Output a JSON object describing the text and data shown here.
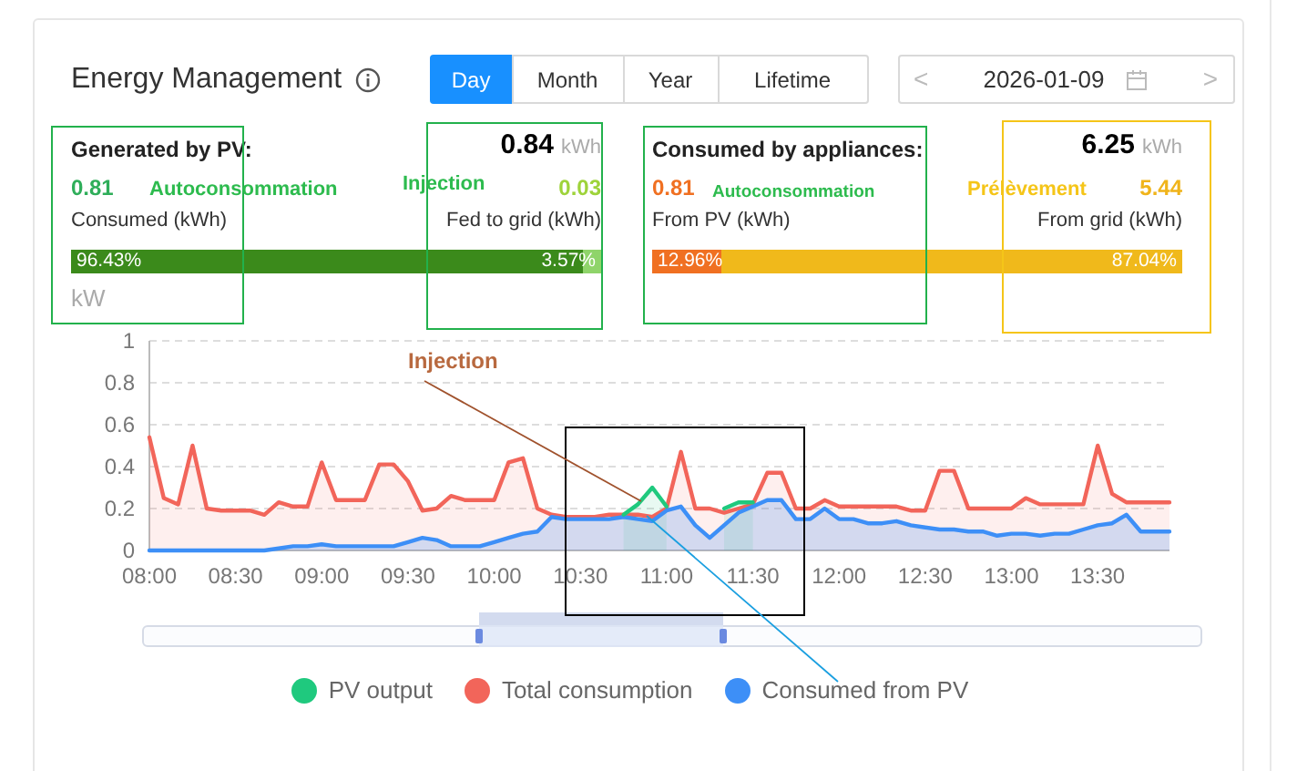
{
  "header": {
    "title": "Energy Management",
    "tabs": [
      {
        "label": "Day",
        "selected": true
      },
      {
        "label": "Month",
        "selected": false
      },
      {
        "label": "Year",
        "selected": false
      },
      {
        "label": "Lifetime",
        "selected": false
      }
    ],
    "prev": "<",
    "date": "2026-01-09",
    "next": ">"
  },
  "summaries": [
    {
      "kind": "generated",
      "title": "Generated by PV:",
      "total": "0.84",
      "unit": "kWh",
      "left": {
        "value": "0.81",
        "label": "Consumed (kWh)",
        "percent": "96.43%"
      },
      "right": {
        "value": "0.03",
        "label": "Fed to grid (kWh)",
        "percent": "3.57%"
      },
      "level": 0.9643
    },
    {
      "kind": "consumed",
      "title": "Consumed by appliances:",
      "total": "6.25",
      "unit": "kWh",
      "left": {
        "value": "0.81",
        "label": "From PV (kWh)",
        "percent": "12.96%"
      },
      "right": {
        "value": "5.44",
        "label": "From grid (kWh)",
        "percent": "87.04%"
      },
      "level": 0.1296
    }
  ],
  "chart": {
    "unit_label": "kW",
    "chart_data": {
      "type": "area",
      "grid": true,
      "x": [
        480,
        485,
        490,
        495,
        500,
        505,
        510,
        515,
        520,
        525,
        530,
        535,
        540,
        545,
        550,
        555,
        560,
        565,
        570,
        575,
        580,
        585,
        590,
        595,
        600,
        605,
        610,
        615,
        620,
        625,
        630,
        635,
        640,
        645,
        650,
        655,
        660,
        665,
        670,
        675,
        680,
        685,
        690,
        695,
        700,
        705,
        710,
        715,
        720,
        725,
        730,
        735,
        740,
        745,
        750,
        755,
        760,
        765,
        770,
        775,
        780,
        785,
        790,
        795,
        800,
        805,
        810,
        815,
        820,
        825,
        830,
        835
      ],
      "series": [
        {
          "name": "PV output",
          "color": "#1fc97e",
          "values": [
            null,
            null,
            null,
            null,
            null,
            null,
            null,
            null,
            null,
            null,
            null,
            null,
            null,
            null,
            null,
            null,
            null,
            null,
            null,
            null,
            null,
            null,
            null,
            null,
            null,
            null,
            null,
            null,
            null,
            null,
            null,
            null,
            null,
            0.17,
            0.22,
            0.3,
            0.21,
            null,
            null,
            null,
            0.2,
            0.23,
            0.23,
            null,
            null,
            null,
            null,
            null,
            null,
            null,
            null,
            null,
            null,
            null,
            null,
            null,
            null,
            null,
            null,
            null,
            null,
            null,
            null,
            null,
            null,
            null,
            null,
            null,
            null,
            null,
            null,
            null
          ]
        },
        {
          "name": "Total consumption",
          "color": "#f2655a",
          "values": [
            0.54,
            0.25,
            0.22,
            0.5,
            0.2,
            0.19,
            0.19,
            0.19,
            0.17,
            0.23,
            0.21,
            0.21,
            0.42,
            0.24,
            0.24,
            0.24,
            0.41,
            0.41,
            0.33,
            0.19,
            0.2,
            0.26,
            0.24,
            0.24,
            0.24,
            0.42,
            0.44,
            0.2,
            0.17,
            0.16,
            0.16,
            0.16,
            0.17,
            0.17,
            0.17,
            0.16,
            0.2,
            0.47,
            0.2,
            0.2,
            0.18,
            0.2,
            0.22,
            0.37,
            0.37,
            0.2,
            0.2,
            0.24,
            0.21,
            0.21,
            0.21,
            0.21,
            0.21,
            0.19,
            0.19,
            0.38,
            0.38,
            0.2,
            0.2,
            0.2,
            0.2,
            0.25,
            0.22,
            0.22,
            0.22,
            0.22,
            0.5,
            0.27,
            0.23,
            0.23,
            0.23,
            0.23
          ]
        },
        {
          "name": "Consumed from PV",
          "color": "#3d8ff7",
          "values": [
            0,
            0,
            0,
            0,
            0,
            0,
            0,
            0,
            0,
            0.01,
            0.02,
            0.02,
            0.03,
            0.02,
            0.02,
            0.02,
            0.02,
            0.02,
            0.04,
            0.06,
            0.05,
            0.02,
            0.02,
            0.02,
            0.04,
            0.06,
            0.08,
            0.09,
            0.16,
            0.15,
            0.15,
            0.15,
            0.15,
            0.16,
            0.15,
            0.14,
            0.19,
            0.21,
            0.12,
            0.06,
            0.12,
            0.18,
            0.21,
            0.24,
            0.24,
            0.15,
            0.15,
            0.2,
            0.15,
            0.15,
            0.13,
            0.13,
            0.14,
            0.12,
            0.11,
            0.1,
            0.1,
            0.09,
            0.09,
            0.07,
            0.08,
            0.08,
            0.07,
            0.08,
            0.08,
            0.1,
            0.12,
            0.13,
            0.17,
            0.09,
            0.09,
            0.09
          ]
        }
      ],
      "xlim": [
        480,
        835
      ],
      "ylim": [
        0,
        1
      ],
      "yticks": [
        0,
        0.2,
        0.4,
        0.6,
        0.8,
        1
      ],
      "xticks": [
        {
          "value": 480,
          "label": "08:00"
        },
        {
          "value": 510,
          "label": "08:30"
        },
        {
          "value": 540,
          "label": "09:00"
        },
        {
          "value": 570,
          "label": "09:30"
        },
        {
          "value": 600,
          "label": "10:00"
        },
        {
          "value": 630,
          "label": "10:30"
        },
        {
          "value": 660,
          "label": "11:00"
        },
        {
          "value": 690,
          "label": "11:30"
        },
        {
          "value": 720,
          "label": "12:00"
        },
        {
          "value": 750,
          "label": "12:30"
        },
        {
          "value": 780,
          "label": "13:00"
        },
        {
          "value": 810,
          "label": "13:30"
        }
      ]
    }
  },
  "annotations": [
    {
      "kind": "box",
      "color": "#22b14c"
    },
    {
      "kind": "box",
      "color": "#22b14c"
    },
    {
      "kind": "box",
      "color": "#22b14c"
    },
    {
      "kind": "box",
      "color": "#f5c518"
    },
    {
      "kind": "box",
      "color": "#000000"
    },
    {
      "kind": "label",
      "text": "Autoconsommation",
      "color": "#2dbb4e"
    },
    {
      "kind": "label",
      "text": "Injection",
      "color": "#2dbb4e"
    },
    {
      "kind": "label",
      "text": "Autoconsommation",
      "color": "#2dbb4e"
    },
    {
      "kind": "label",
      "text": "Prélèvement",
      "color": "#f5c518"
    },
    {
      "kind": "label",
      "text": "Injection",
      "color": "#b8693f"
    },
    {
      "kind": "line",
      "color": "#a0522d"
    },
    {
      "kind": "line",
      "color": "#1a9fe0"
    }
  ]
}
